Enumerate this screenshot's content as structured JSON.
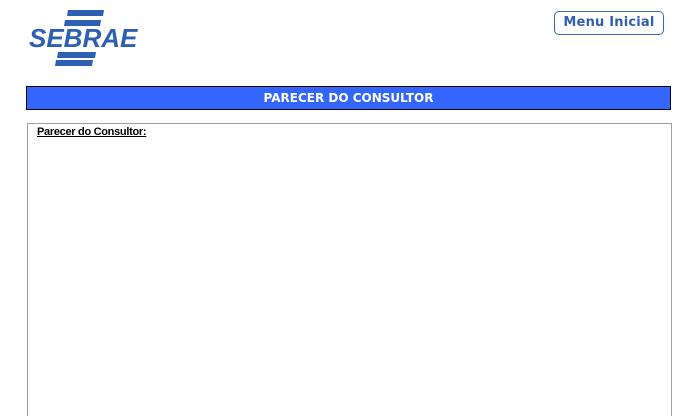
{
  "header": {
    "logo_text": "SEBRAE",
    "menu_button_label": "Menu Inicial"
  },
  "section": {
    "title": "PARECER DO CONSULTOR"
  },
  "content": {
    "field_label": "Parecer do Consultor:",
    "field_value": ""
  },
  "colors": {
    "brand_blue": "#2f5fb3",
    "title_bar_bg": "#3366ff",
    "title_bar_text": "#ffffff"
  }
}
